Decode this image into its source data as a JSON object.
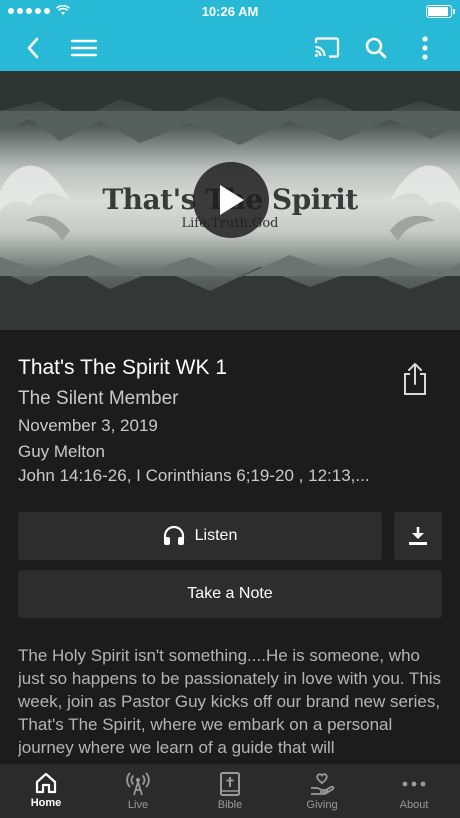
{
  "status_bar": {
    "time": "10:26 AM",
    "battery_level": 1.0
  },
  "nav": {
    "icons": [
      "back-icon",
      "menu-icon",
      "cast-icon",
      "search-icon",
      "more-icon"
    ]
  },
  "hero": {
    "title": "That's The Spirit",
    "tagline": "Life.Truth.God"
  },
  "message": {
    "title": "That's The Spirit WK 1",
    "series": "The Silent Member",
    "date": "November 3, 2019",
    "speaker": "Guy Melton",
    "scripture": "John 14:16-26, I Corinthians 6;19-20 , 12:13,..."
  },
  "actions": {
    "listen": "Listen",
    "take_note": "Take a Note"
  },
  "description": "The Holy Spirit isn't something....He is someone, who just so happens to be passionately in love with you. This week, join as Pastor Guy kicks off our brand new series, That's The Spirit, where we embark on a personal journey where we learn of a guide that will",
  "tabs": [
    {
      "label": "Home",
      "icon": "home-icon",
      "active": true
    },
    {
      "label": "Live",
      "icon": "antenna-icon",
      "active": false
    },
    {
      "label": "Bible",
      "icon": "bible-icon",
      "active": false
    },
    {
      "label": "Giving",
      "icon": "giving-icon",
      "active": false
    },
    {
      "label": "About",
      "icon": "ellipsis-icon",
      "active": false
    }
  ],
  "colors": {
    "accent": "#27b9d6",
    "background": "#1c1c1c",
    "button": "#2d2d2d"
  }
}
